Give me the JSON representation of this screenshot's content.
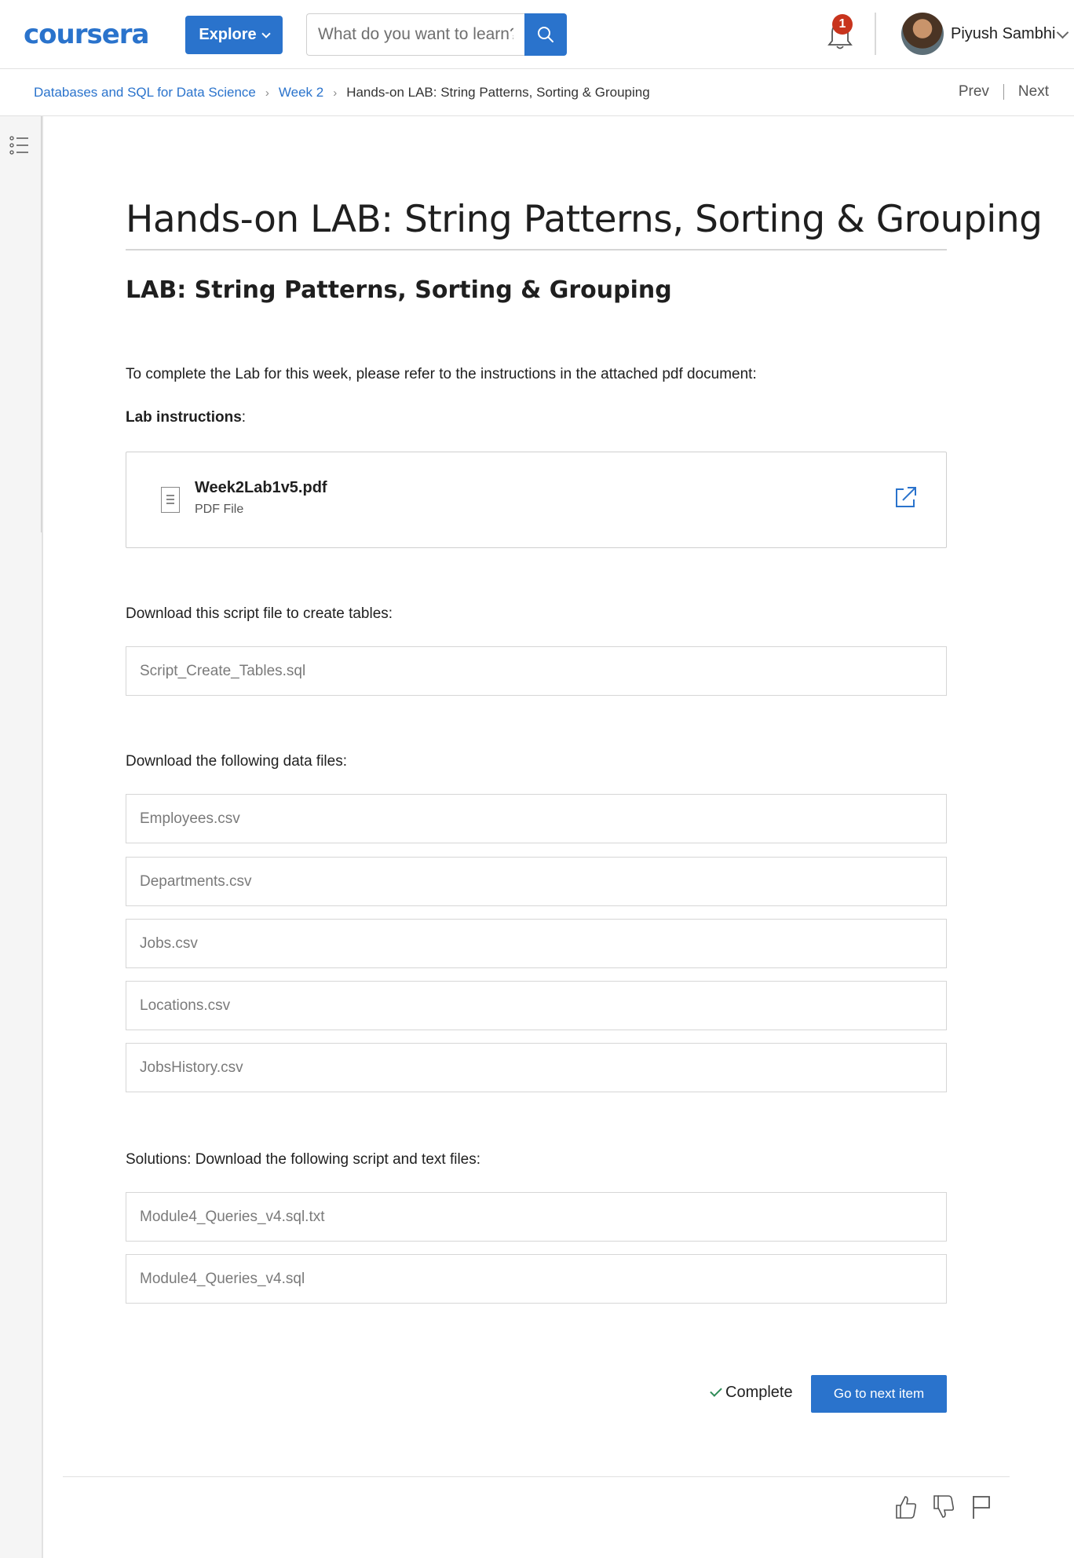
{
  "header": {
    "logo": "coursera",
    "explore_label": "Explore",
    "search": {
      "placeholder": "What do you want to learn?",
      "value": ""
    },
    "notifications_count": "1",
    "user_name": "Piyush Sambhi"
  },
  "breadcrumb": {
    "items": [
      {
        "label": "Databases and SQL for Data Science"
      },
      {
        "label": "Week 2"
      },
      {
        "label": "Hands-on LAB: String Patterns, Sorting & Grouping"
      }
    ],
    "prev_label": "Prev",
    "next_label": "Next"
  },
  "content": {
    "title": "Hands-on LAB: String Patterns, Sorting & Grouping",
    "subtitle": "LAB: String Patterns, Sorting & Grouping",
    "intro": "To complete the Lab for this week, please refer to the instructions in the attached pdf document:",
    "lab_instructions_label": "Lab instructions",
    "lab_instructions_colon": ":",
    "attachment": {
      "name": "Week2Lab1v5.pdf",
      "type": "PDF File"
    },
    "script_heading": "Download this script file to create tables:",
    "script_files": [
      "Script_Create_Tables.sql"
    ],
    "data_heading": "Download the following data files:",
    "data_files": [
      "Employees.csv",
      "Departments.csv",
      "Jobs.csv",
      "Locations.csv",
      "JobsHistory.csv"
    ],
    "solutions_heading": "Solutions: Download the following script and text files:",
    "solution_files": [
      "Module4_Queries_v4.sql.txt",
      "Module4_Queries_v4.sql"
    ]
  },
  "actions": {
    "complete_label": "Complete",
    "next_item_label": "Go to next item"
  },
  "colors": {
    "accent": "#2a73cc",
    "badge": "#c8341d",
    "complete_check": "#2e8b57"
  },
  "icons": [
    "search-icon",
    "bell-icon",
    "chevron-down-icon",
    "table-of-contents-icon",
    "document-icon",
    "external-link-icon",
    "thumbs-up-icon",
    "thumbs-down-icon",
    "flag-icon"
  ]
}
